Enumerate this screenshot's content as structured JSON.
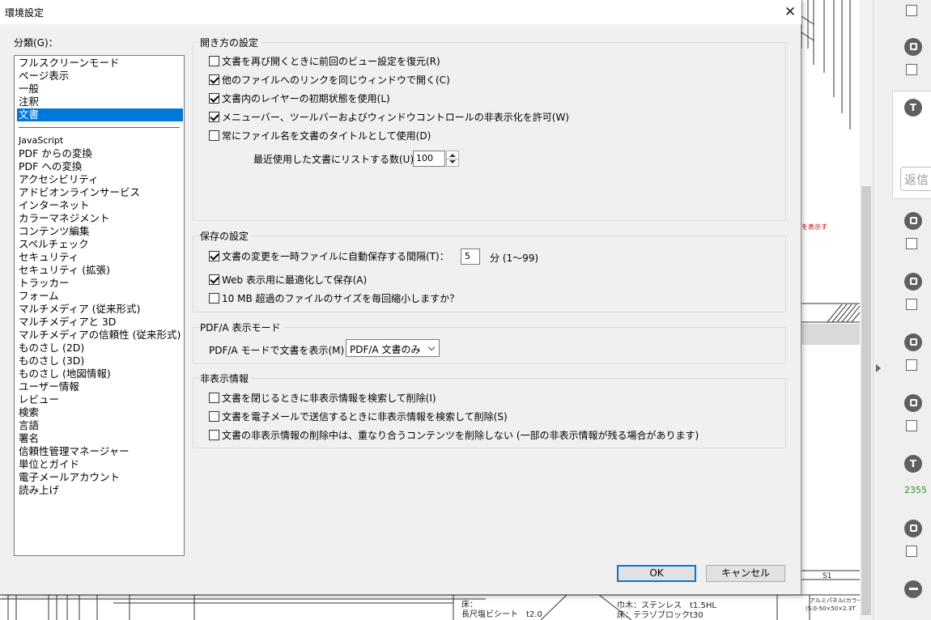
{
  "dialog": {
    "title": "環境設定",
    "category_label": "分類(G)：",
    "categories_top": [
      "フルスクリーンモード",
      "ページ表示",
      "一般",
      "注釈",
      "文書"
    ],
    "selected_category": "文書",
    "categories_bottom": [
      "JavaScript",
      "PDF からの変換",
      "PDF への変換",
      "アクセシビリティ",
      "アドビオンラインサービス",
      "インターネット",
      "カラーマネジメント",
      "コンテンツ編集",
      "スペルチェック",
      "セキュリティ",
      "セキュリティ (拡張)",
      "トラッカー",
      "フォーム",
      "マルチメディア (従来形式)",
      "マルチメディアと 3D",
      "マルチメディアの信頼性 (従来形式)",
      "ものさし (2D)",
      "ものさし (3D)",
      "ものさし (地図情報)",
      "ユーザー情報",
      "レビュー",
      "検索",
      "言語",
      "署名",
      "信頼性管理マネージャー",
      "単位とガイド",
      "電子メールアカウント",
      "読み上げ"
    ]
  },
  "open_settings": {
    "title": "開き方の設定",
    "options": [
      {
        "label": "文書を再び開くときに前回のビュー設定を復元(R)",
        "checked": false
      },
      {
        "label": "他のファイルへのリンクを同じウィンドウで開く(C)",
        "checked": true
      },
      {
        "label": "文書内のレイヤーの初期状態を使用(L)",
        "checked": true
      },
      {
        "label": "メニューバー、ツールバーおよびウィンドウコントロールの非表示化を許可(W)",
        "checked": true
      },
      {
        "label": "常にファイル名を文書のタイトルとして使用(D)",
        "checked": false
      }
    ],
    "recent_label": "最近使用した文書にリストする数(U)：",
    "recent_value": "100"
  },
  "save_settings": {
    "title": "保存の設定",
    "autosave_label": "文書の変更を一時ファイルに自動保存する間隔(T)：",
    "autosave_checked": true,
    "interval_value": "5",
    "interval_unit": "分 (1～99)",
    "web_label": "Web 表示用に最適化して保存(A)",
    "web_checked": true,
    "reduce_label": "10 MB 超過のファイルのサイズを毎回縮小しますか？",
    "reduce_checked": false
  },
  "pdfa": {
    "title": "PDF/A 表示モード",
    "label": "PDF/A モードで文書を表示(M)：",
    "value": "PDF/A 文書のみ"
  },
  "hidden_info": {
    "title": "非表示情報",
    "options": [
      {
        "label": "文書を閉じるときに非表示情報を検索して削除(I)",
        "checked": false
      },
      {
        "label": "文書を電子メールで送信するときに非表示情報を検索して削除(S)",
        "checked": false
      },
      {
        "label": "文書の非表示情報の削除中は、重なり合うコンテンツを削除しない (一部の非表示情報が残る場合があります)",
        "checked": false
      }
    ]
  },
  "buttons": {
    "ok": "OK",
    "cancel": "キャンセル"
  },
  "background": {
    "panel_reply": "返信",
    "panel_number": "2355",
    "drawing_texts": [
      "床：",
      "長尺塩ビシート　t2.0",
      "巾木：ステンレス　t1.5HL",
      "床：テラゾブロックt30",
      "S1",
      "アルミパネル(カラー)",
      "(S:0-50×50×2.3T",
      "を表示す"
    ]
  },
  "colors": {
    "accent": "#0078d7",
    "dialog_bg": "#f0f0f0"
  }
}
